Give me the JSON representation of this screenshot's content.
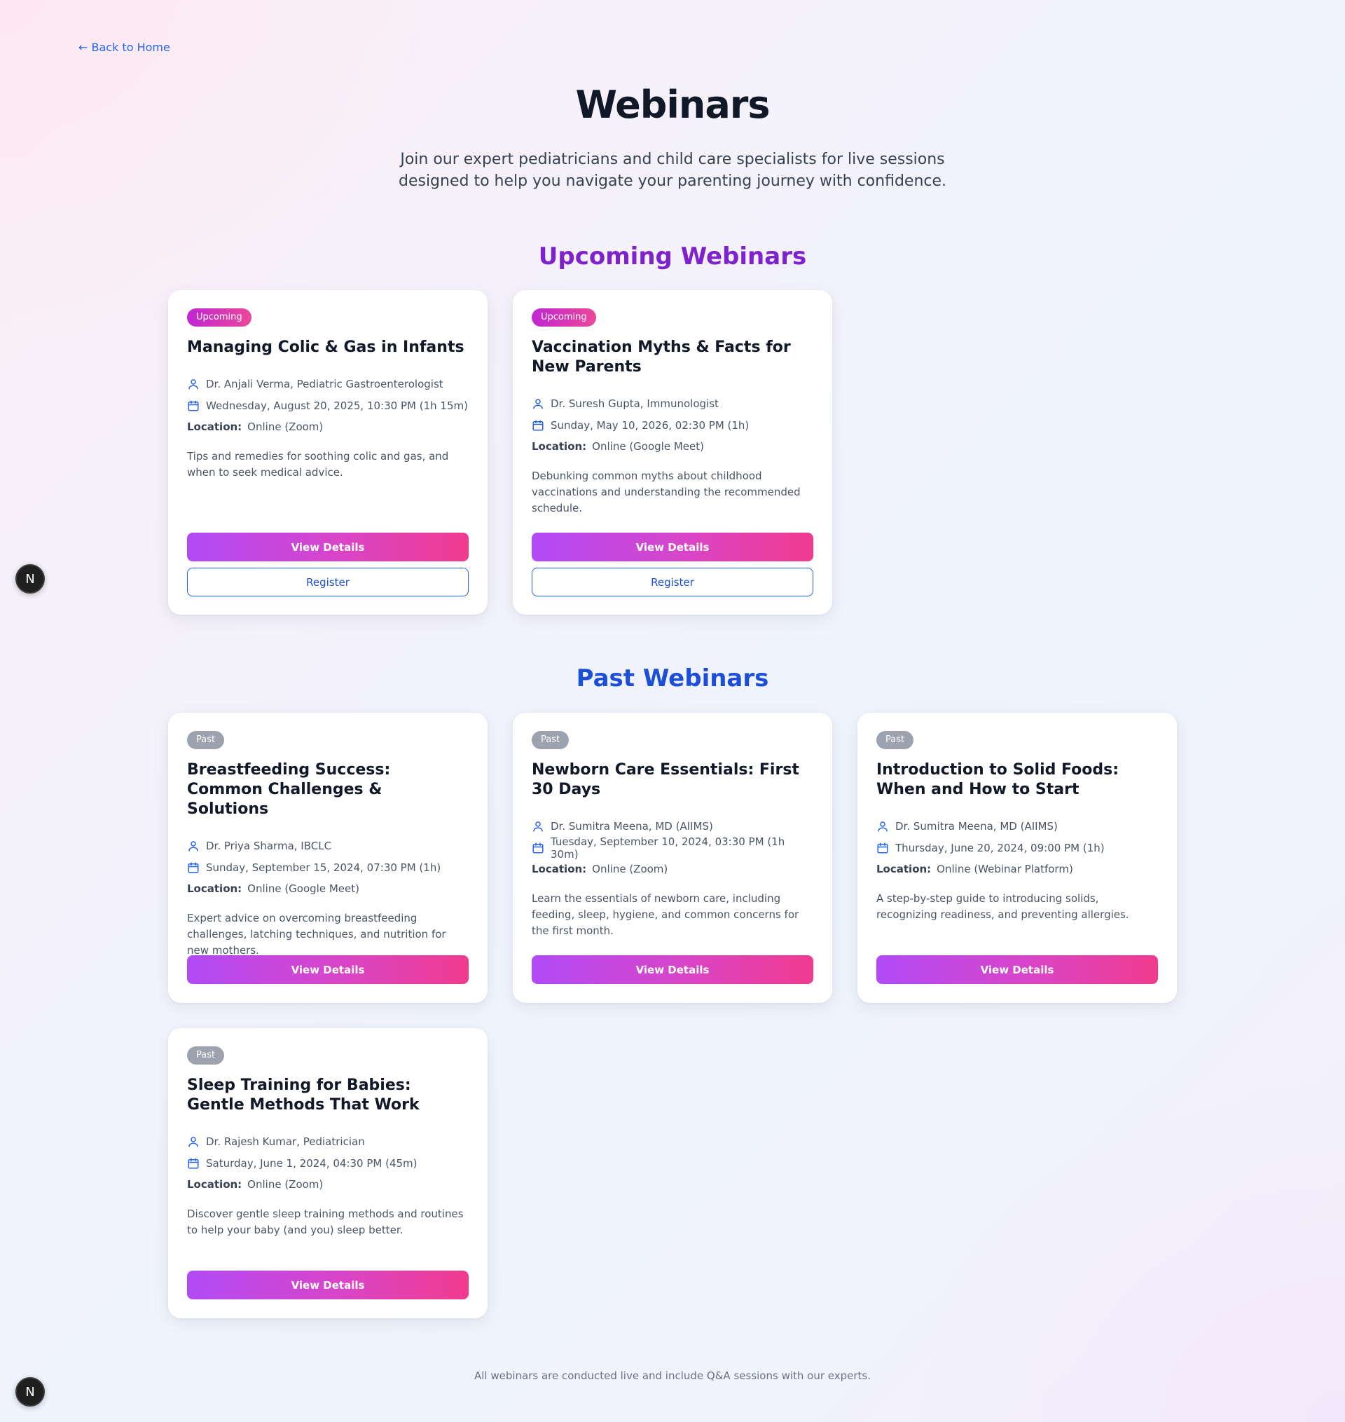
{
  "nav": {
    "back_label": "← Back to Home"
  },
  "header": {
    "title": "Webinars",
    "subtitle": "Join our expert pediatricians and child care specialists for live sessions designed to help you navigate your parenting journey with confidence."
  },
  "sections": {
    "upcoming_title": "Upcoming Webinars",
    "past_title": "Past Webinars"
  },
  "labels": {
    "location": "Location:",
    "view_details": "View Details",
    "register": "Register"
  },
  "upcoming": [
    {
      "badge": "Upcoming",
      "title": "Managing Colic & Gas in Infants",
      "speaker": "Dr. Anjali Verma, Pediatric Gastroenterologist",
      "datetime": "Wednesday, August 20, 2025, 10:30 PM (1h 15m)",
      "location": "Online (Zoom)",
      "description": "Tips and remedies for soothing colic and gas, and when to seek medical advice."
    },
    {
      "badge": "Upcoming",
      "title": "Vaccination Myths & Facts for New Parents",
      "speaker": "Dr. Suresh Gupta, Immunologist",
      "datetime": "Sunday, May 10, 2026, 02:30 PM (1h)",
      "location": "Online (Google Meet)",
      "description": "Debunking common myths about childhood vaccinations and understanding the recommended schedule."
    }
  ],
  "past": [
    {
      "badge": "Past",
      "title": "Breastfeeding Success: Common Challenges & Solutions",
      "speaker": "Dr. Priya Sharma, IBCLC",
      "datetime": "Sunday, September 15, 2024, 07:30 PM (1h)",
      "location": "Online (Google Meet)",
      "description": "Expert advice on overcoming breastfeeding challenges, latching techniques, and nutrition for new mothers."
    },
    {
      "badge": "Past",
      "title": "Newborn Care Essentials: First 30 Days",
      "speaker": "Dr. Sumitra Meena, MD (AIIMS)",
      "datetime": "Tuesday, September 10, 2024, 03:30 PM (1h 30m)",
      "location": "Online (Zoom)",
      "description": "Learn the essentials of newborn care, including feeding, sleep, hygiene, and common concerns for the first month."
    },
    {
      "badge": "Past",
      "title": "Introduction to Solid Foods: When and How to Start",
      "speaker": "Dr. Sumitra Meena, MD (AIIMS)",
      "datetime": "Thursday, June 20, 2024, 09:00 PM (1h)",
      "location": "Online (Webinar Platform)",
      "description": "A step-by-step guide to introducing solids, recognizing readiness, and preventing allergies."
    },
    {
      "badge": "Past",
      "title": "Sleep Training for Babies: Gentle Methods That Work",
      "speaker": "Dr. Rajesh Kumar, Pediatrician",
      "datetime": "Saturday, June 1, 2024, 04:30 PM (45m)",
      "location": "Online (Zoom)",
      "description": "Discover gentle sleep training methods and routines to help your baby (and you) sleep better."
    }
  ],
  "footer": {
    "note": "All webinars are conducted live and include Q&A sessions with our experts."
  },
  "dev_badge": {
    "letter": "N"
  },
  "icons": {
    "speaker": "user-icon",
    "date": "calendar-icon"
  },
  "colors": {
    "upcoming_heading": "#7e22ce",
    "past_heading": "#1d4ed8",
    "link": "#2563eb",
    "button_gradient_start": "#b14bf7",
    "button_gradient_end": "#f03b8e",
    "badge_past": "#9ca3af"
  }
}
